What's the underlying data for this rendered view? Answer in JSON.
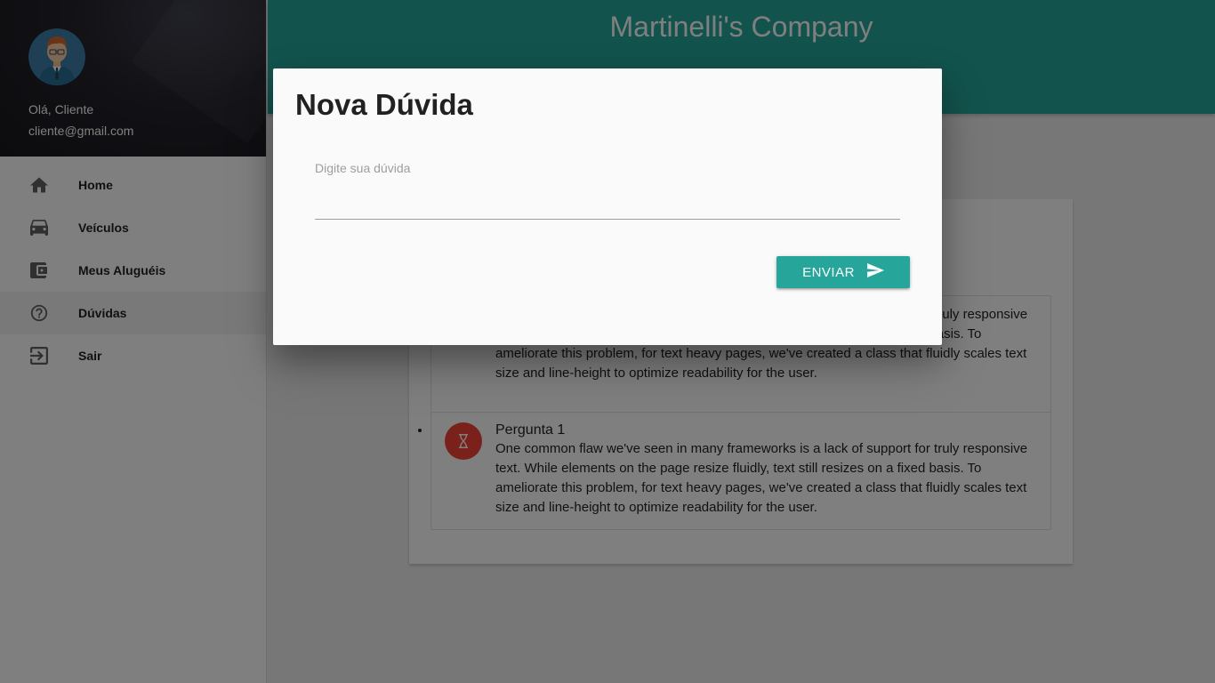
{
  "sidebar": {
    "user": {
      "greeting": "Olá, Cliente",
      "email": "cliente@gmail.com",
      "avatar_icon": "user-avatar-icon"
    },
    "items": [
      {
        "label": "Home",
        "icon": "home-icon",
        "active": false
      },
      {
        "label": "Veículos",
        "icon": "car-icon",
        "active": false
      },
      {
        "label": "Meus Aluguéis",
        "icon": "wallet-icon",
        "active": false
      },
      {
        "label": "Dúvidas",
        "icon": "help-circle-icon",
        "active": true
      },
      {
        "label": "Sair",
        "icon": "exit-icon",
        "active": false
      }
    ]
  },
  "header": {
    "brand": "Martinelli's Company"
  },
  "questions": [
    {
      "title": "",
      "text": "One common flaw we've seen in many frameworks is a lack of support for truly responsive text. While elements on the page resize fluidly, text still resizes on a fixed basis. To ameliorate this problem, for text heavy pages, we've created a class that fluidly scales text size and line-height to optimize readability for the user.",
      "status_icon": "hourglass-icon"
    },
    {
      "title": "Pergunta 1",
      "text": "One common flaw we've seen in many frameworks is a lack of support for truly responsive text. While elements on the page resize fluidly, text still resizes on a fixed basis. To ameliorate this problem, for text heavy pages, we've created a class that fluidly scales text size and line-height to optimize readability for the user.",
      "status_icon": "hourglass-icon"
    }
  ],
  "modal": {
    "title": "Nova Dúvida",
    "field_label": "Digite sua dúvida",
    "field_value": "",
    "send_label": "ENVIAR",
    "send_icon": "send-icon"
  },
  "colors": {
    "primary": "#26a69a",
    "status": "#f44336",
    "overlay": "rgba(0,0,0,0.5)"
  }
}
